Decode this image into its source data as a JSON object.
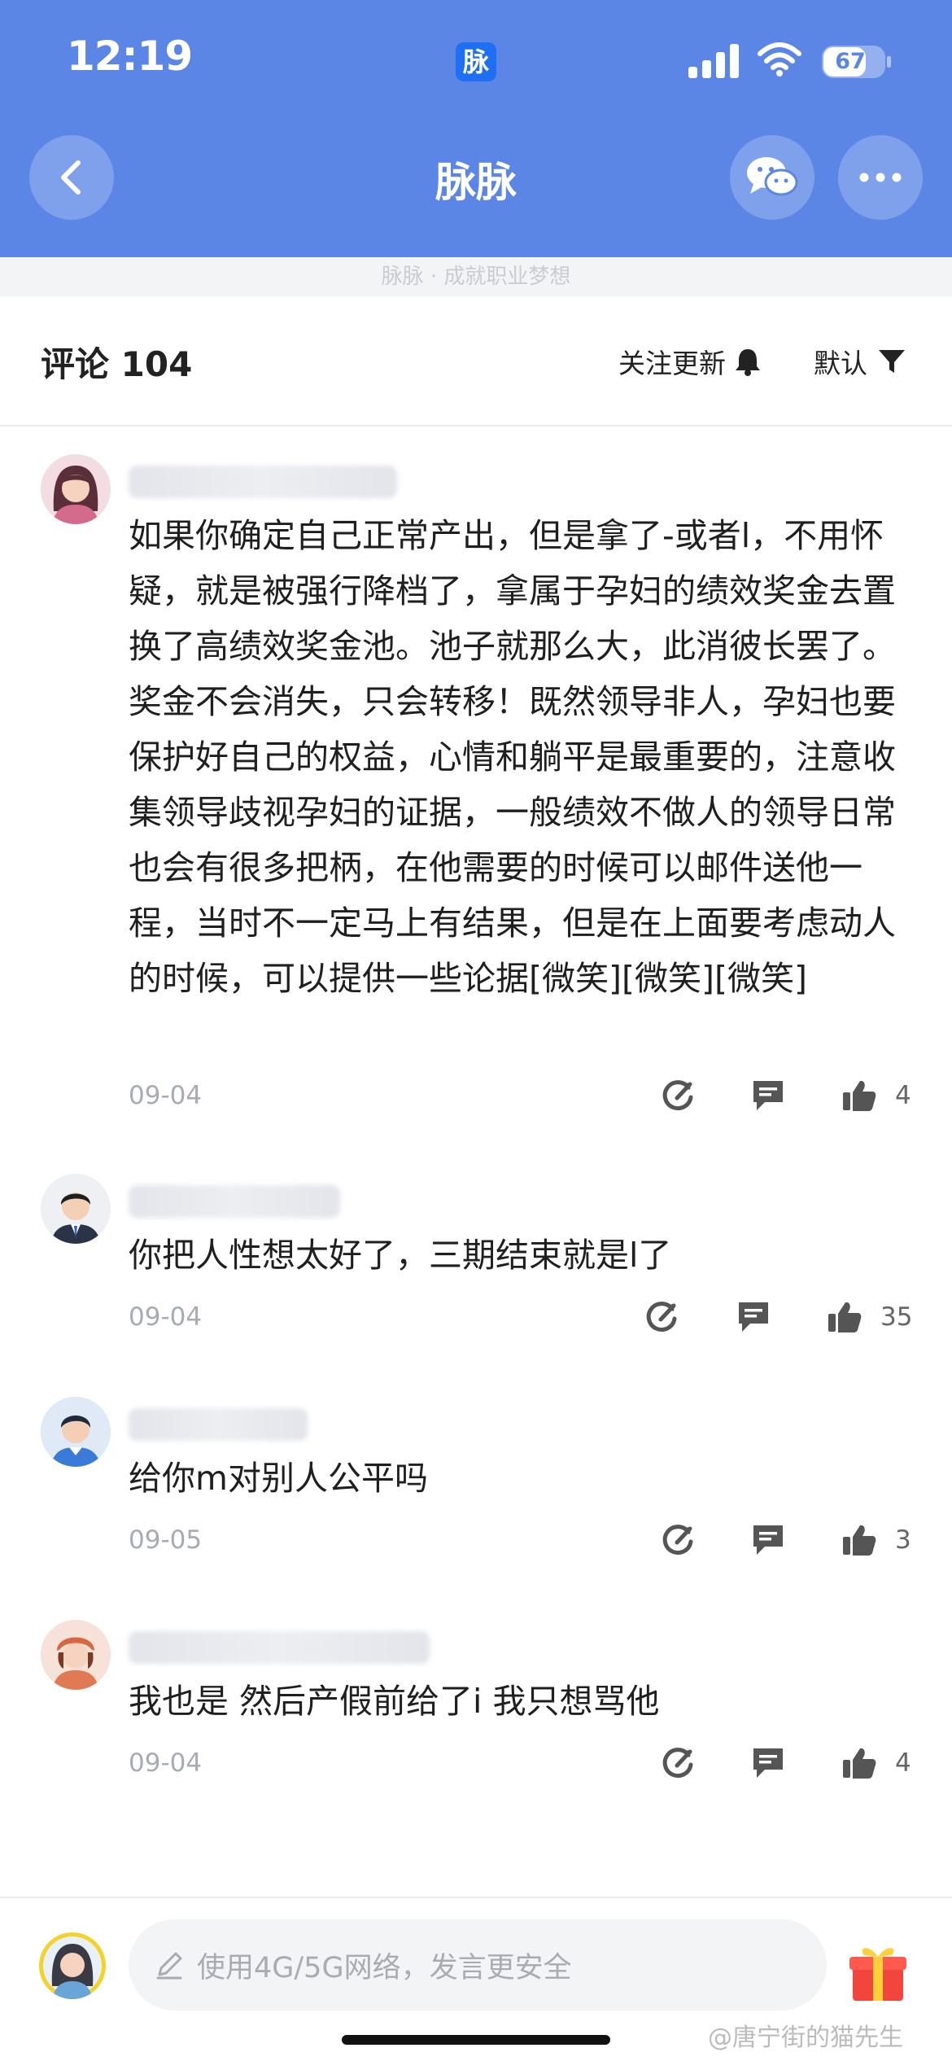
{
  "status": {
    "time": "12:19",
    "app_badge": "脉",
    "battery": "67"
  },
  "nav": {
    "title": "脉脉"
  },
  "slogan": "脉脉 · 成就职业梦想",
  "comments_header": {
    "title": "评论 104",
    "follow": "关注更新",
    "sort": "默认"
  },
  "comments": [
    {
      "text": "如果你确定自己正常产出，但是拿了-或者l，不用怀疑，就是被强行降档了，拿属于孕妇的绩效奖金去置换了高绩效奖金池。池子就那么大，此消彼长罢了。奖金不会消失，只会转移！既然领导非人，孕妇也要保护好自己的权益，心情和躺平是最重要的，注意收集领导歧视孕妇的证据，一般绩效不做人的领导日常也会有很多把柄，在他需要的时候可以邮件送他一程，当时不一定马上有结果，但是在上面要考虑动人的时候，可以提供一些论据[微笑][微笑][微笑]",
      "date": "09-04",
      "likes": "4"
    },
    {
      "text": "你把人性想太好了，三期结束就是l了",
      "date": "09-04",
      "likes": "35"
    },
    {
      "text": "给你m对别人公平吗",
      "date": "09-05",
      "likes": "3"
    },
    {
      "text": "我也是 然后产假前给了i 我只想骂他",
      "date": "09-04",
      "likes": "4"
    }
  ],
  "composer": {
    "placeholder": "使用4G/5G网络，发言更安全"
  },
  "watermark": "@唐宁街的猫先生",
  "icons": {
    "back": "chevron-left-icon",
    "wechat": "wechat-icon",
    "more": "more-icon",
    "bell": "bell-icon",
    "filter": "filter-icon",
    "share": "share-icon",
    "reply": "comment-icon",
    "like": "thumbs-up-icon",
    "edit": "pencil-icon",
    "gift": "gift-icon"
  },
  "colors": {
    "header": "#5b86e5",
    "app_badge": "#1e6ff1"
  }
}
